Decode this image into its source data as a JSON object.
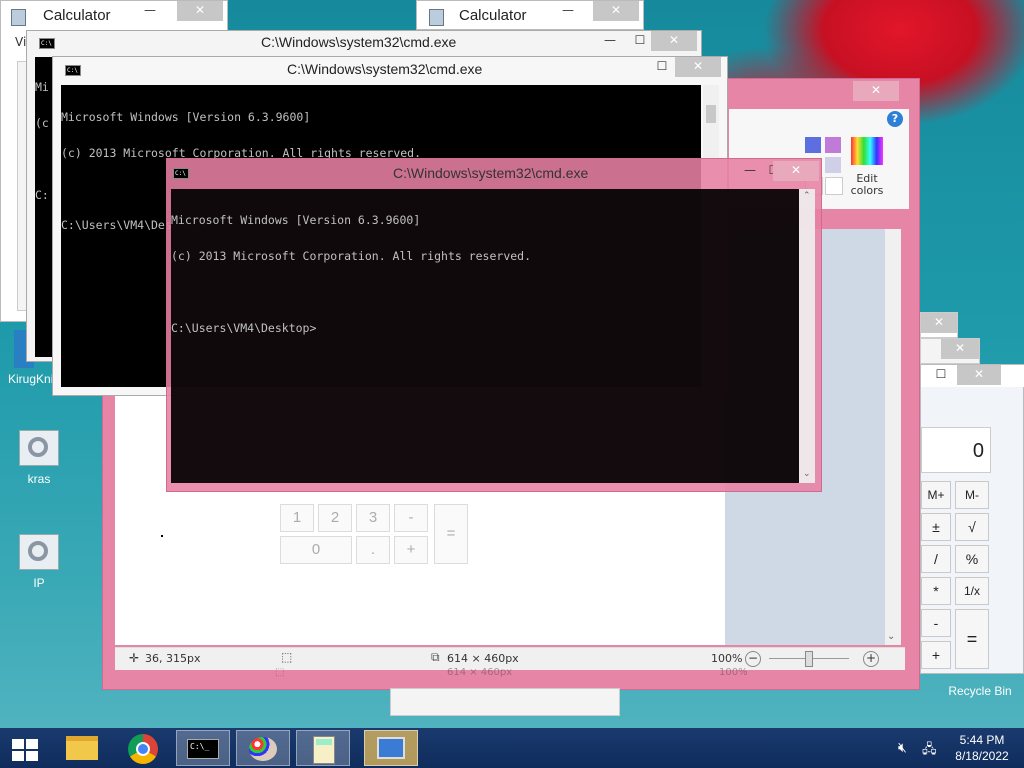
{
  "calc_bg1": {
    "title": "Calculator",
    "menu_fragment": "Vi"
  },
  "calc_bg2": {
    "title": "Calculator"
  },
  "cmd_back": {
    "title": "C:\\Windows\\system32\\cmd.exe",
    "line1_fragment": "Mi",
    "line2_fragment": "(c",
    "line4_fragment": "C:"
  },
  "cmd_mid": {
    "title": "C:\\Windows\\system32\\cmd.exe",
    "lines": [
      "Microsoft Windows [Version 6.3.9600]",
      "(c) 2013 Microsoft Corporation. All rights reserved.",
      "",
      "C:\\Users\\VM4\\Desktop>"
    ]
  },
  "cmd_front": {
    "title": "C:\\Windows\\system32\\cmd.exe",
    "lines": [
      "Microsoft Windows [Version 6.3.9600]",
      "(c) 2013 Microsoft Corporation. All rights reserved.",
      "",
      "C:\\Users\\VM4\\Desktop>"
    ]
  },
  "paint": {
    "edit_colors": "Edit colors",
    "help": "?",
    "status_pos": "36, 315px",
    "status_size": "614 × 460px",
    "status_size_ghost": "614 × 460px",
    "zoom": "100%",
    "zoom_ghost": "100%",
    "minus": "−",
    "plus": "+"
  },
  "calc_front": {
    "display": "0",
    "buttons": [
      {
        "label": "M+"
      },
      {
        "label": "M-"
      },
      {
        "label": "±"
      },
      {
        "label": "√"
      },
      {
        "label": "/"
      },
      {
        "label": "%"
      },
      {
        "label": "*"
      },
      {
        "label": "1/x"
      },
      {
        "label": "-"
      },
      {
        "label": "="
      },
      {
        "label": "+"
      }
    ]
  },
  "calc_ghost": {
    "buttons": [
      {
        "label": "1"
      },
      {
        "label": "2"
      },
      {
        "label": "3"
      },
      {
        "label": "-"
      },
      {
        "label": "="
      },
      {
        "label": "0"
      },
      {
        "label": "."
      },
      {
        "label": "+"
      }
    ]
  },
  "desktop_icons": [
    {
      "label": "KirugKni"
    },
    {
      "label": "kras"
    },
    {
      "label": "IP"
    },
    {
      "label": "Recycle Bin"
    }
  ],
  "tray": {
    "time": "5:44 PM",
    "date": "8/18/2022"
  },
  "window_controls": {
    "minimize": "—",
    "maximize": "☐",
    "close": "✕"
  }
}
